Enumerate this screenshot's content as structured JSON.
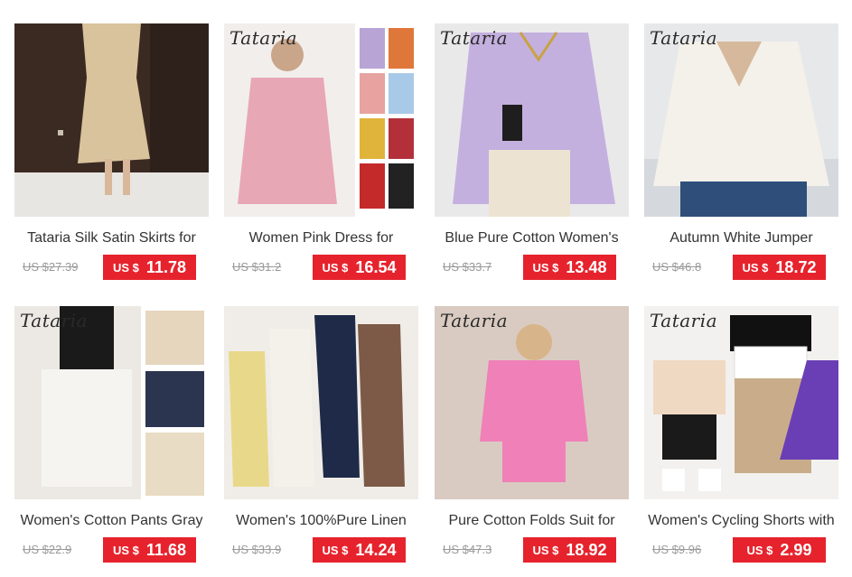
{
  "products": [
    {
      "brand": "",
      "title": "Tataria Silk Satin Skirts for",
      "old_price": "US $27.39",
      "currency": "US $",
      "price": "11.78"
    },
    {
      "brand": "Tataria",
      "title": "Women Pink Dress for",
      "old_price": "US $31.2",
      "currency": "US $",
      "price": "16.54"
    },
    {
      "brand": "Tataria",
      "title": "Blue Pure Cotton Women's",
      "old_price": "US $33.7",
      "currency": "US $",
      "price": "13.48"
    },
    {
      "brand": "Tataria",
      "title": "Autumn White Jumper",
      "old_price": "US $46.8",
      "currency": "US $",
      "price": "18.72"
    },
    {
      "brand": "Tataria",
      "title": "Women's Cotton Pants Gray",
      "old_price": "US $22.9",
      "currency": "US $",
      "price": "11.68"
    },
    {
      "brand": "",
      "title": "Women's 100%Pure Linen",
      "old_price": "US $33.9",
      "currency": "US $",
      "price": "14.24"
    },
    {
      "brand": "Tataria",
      "title": "Pure Cotton Folds Suit for",
      "old_price": "US $47.3",
      "currency": "US $",
      "price": "18.92"
    },
    {
      "brand": "Tataria",
      "title": "Women's Cycling Shorts with",
      "old_price": "US $9.96",
      "currency": "US $",
      "price": "2.99"
    }
  ],
  "colors": {
    "price_bg": "#e6232d",
    "old_price": "#999999",
    "title": "#333333"
  }
}
